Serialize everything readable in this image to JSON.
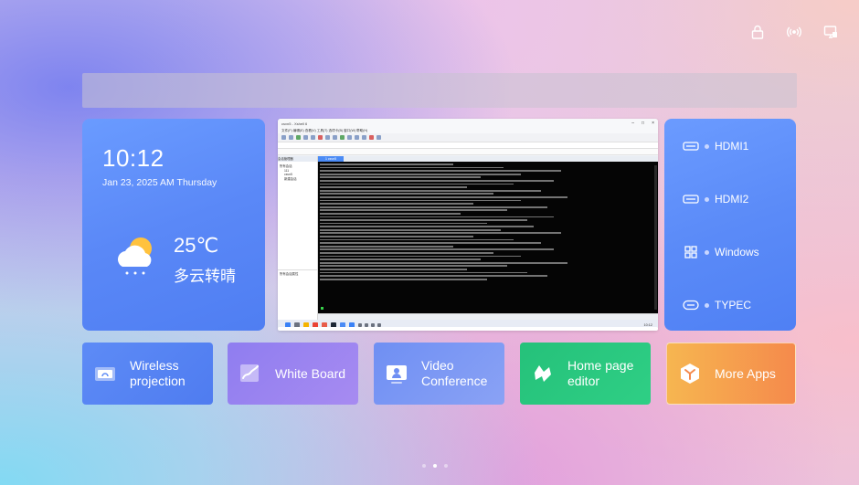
{
  "status": {
    "icons": [
      "lock-icon",
      "wireless-signal-icon",
      "screen-share-icon"
    ]
  },
  "clock": {
    "time": "10:12",
    "date": "Jan 23, 2025  AM Thursday"
  },
  "weather": {
    "temperature": "25℃",
    "description": "多云转晴",
    "icon": "partly-cloudy-rain-icon"
  },
  "preview": {
    "window_title": "csvn5 - Xshell 6",
    "menu": "文件(F)  编辑(E)  查看(V)  工具(T)  选项卡(B)  窗口(W)  帮助(H)",
    "session_panel_title": "会话管理器",
    "sessions": [
      "所有会话",
      "111",
      "csvn5",
      "新建会话"
    ],
    "props_title": "所有会话属性",
    "tab_label": "1 csvn5",
    "taskbar_time": "10:12"
  },
  "sources": [
    {
      "label": "HDMI1",
      "icon": "hdmi-icon"
    },
    {
      "label": "HDMI2",
      "icon": "hdmi-icon"
    },
    {
      "label": "Windows",
      "icon": "windows-icon"
    },
    {
      "label": "TYPEC",
      "icon": "typec-icon"
    }
  ],
  "tiles": {
    "wireless": {
      "label": "Wireless projection",
      "icon": "wireless-projection-icon"
    },
    "board": {
      "label": "White Board",
      "icon": "whiteboard-icon"
    },
    "video": {
      "label": "Video Conference",
      "icon": "video-conference-icon"
    },
    "editor": {
      "label": "Home page editor",
      "icon": "home-editor-icon"
    },
    "apps": {
      "label": "More Apps",
      "icon": "more-apps-icon"
    }
  },
  "pager": {
    "count": 3,
    "active": 1
  },
  "colors": {
    "card_blue": "#5a88f7",
    "tile_green": "#25c17a",
    "tile_orange": "#f58a4c",
    "tile_purple": "#a78bf1"
  }
}
